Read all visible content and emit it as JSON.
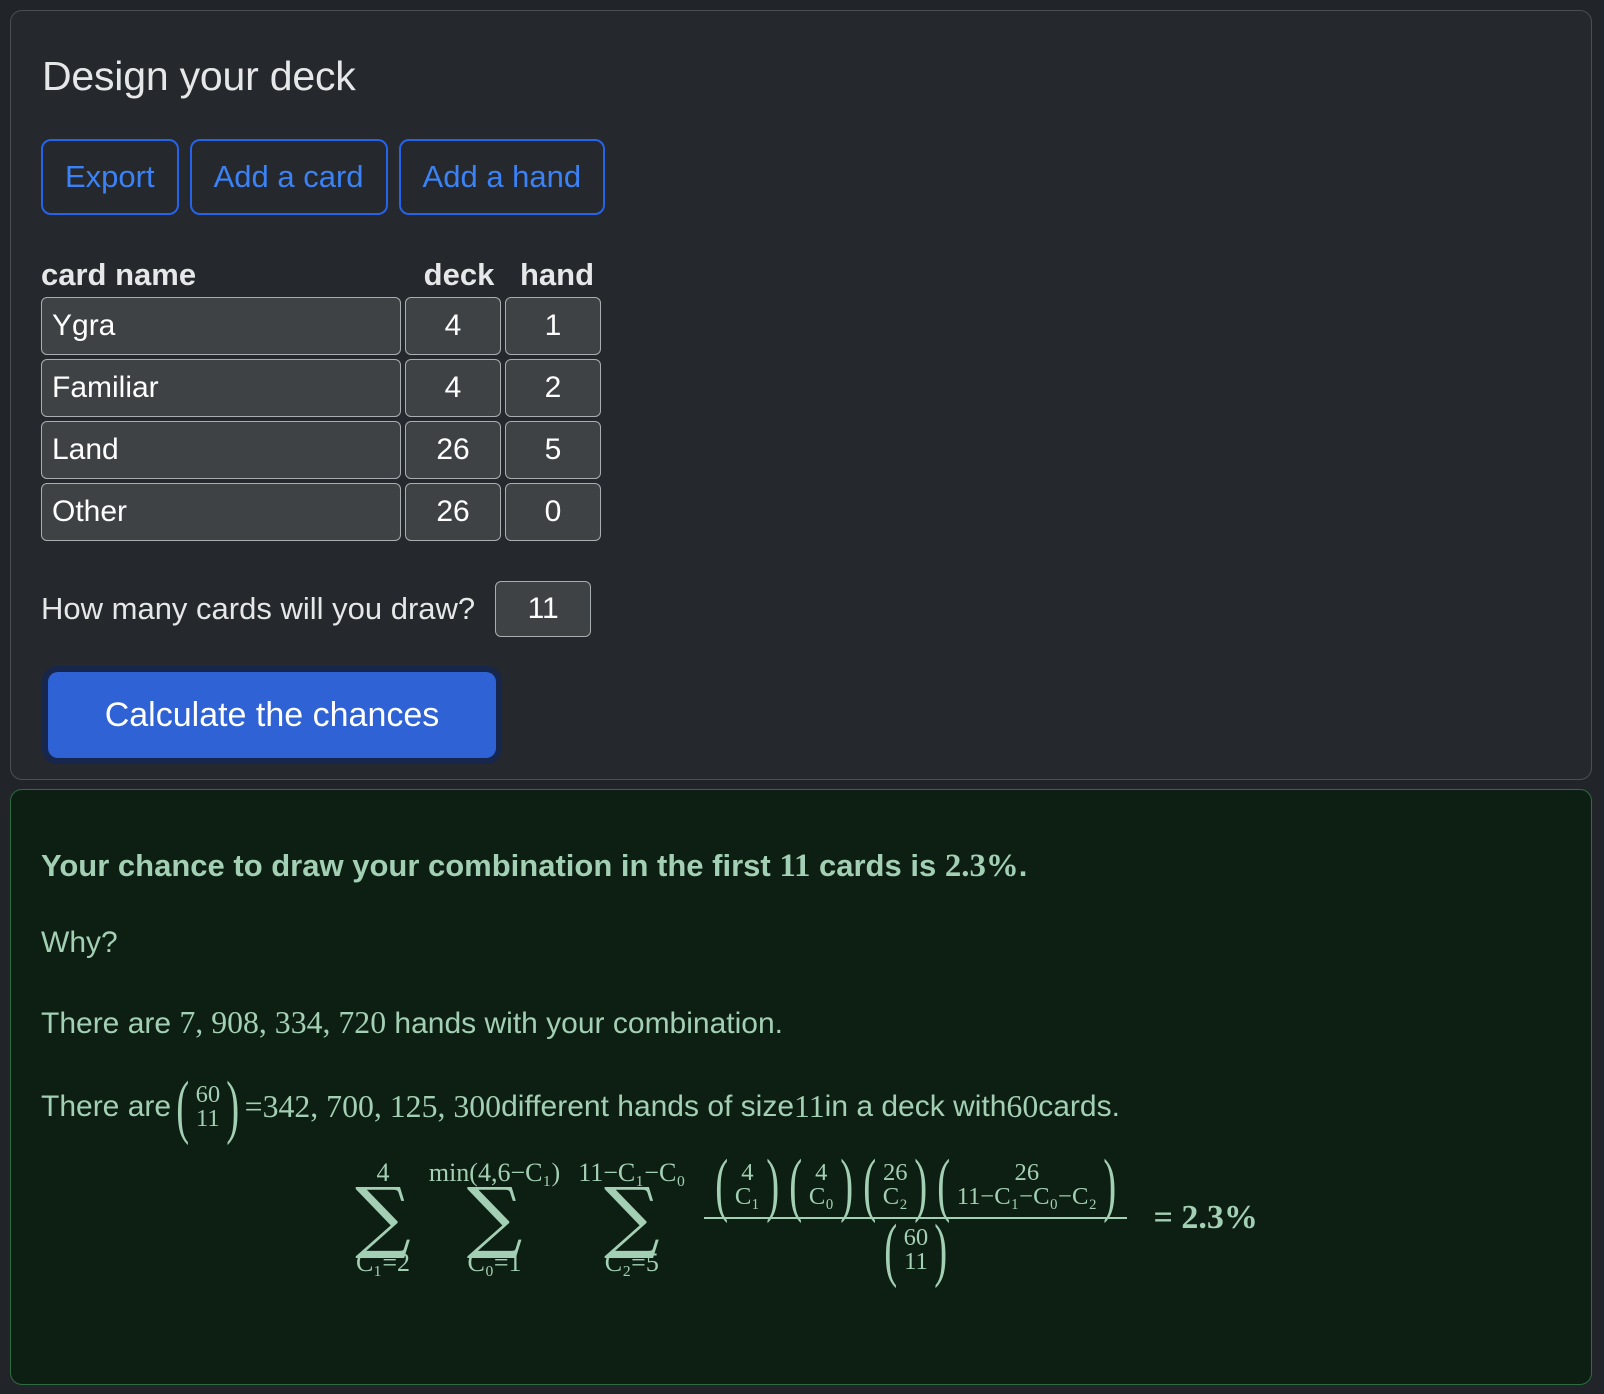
{
  "deck_panel": {
    "title": "Design your deck",
    "buttons": [
      {
        "label": "Export",
        "name": "export-button"
      },
      {
        "label": "Add a card",
        "name": "add-a-card-button"
      },
      {
        "label": "Add a hand",
        "name": "add-a-hand-button"
      }
    ],
    "table": {
      "headers": {
        "name": "card name",
        "deck": "deck",
        "hand": "hand"
      },
      "rows": [
        {
          "name": "Ygra",
          "deck": "4",
          "hand": "1"
        },
        {
          "name": "Familiar",
          "deck": "4",
          "hand": "2"
        },
        {
          "name": "Land",
          "deck": "26",
          "hand": "5"
        },
        {
          "name": "Other",
          "deck": "26",
          "hand": "0"
        }
      ]
    },
    "draw": {
      "label": "How many cards will you draw?",
      "value": "11"
    },
    "calculate_label": "Calculate the chances"
  },
  "result_panel": {
    "headline": {
      "prefix": "Your chance to draw your combination in the first ",
      "draw_count": "11",
      "middle": " cards is ",
      "probability": "2.3%",
      "suffix": "."
    },
    "why_label": "Why?",
    "hands_line": {
      "prefix": "There are ",
      "count": "7, 908, 334, 720",
      "suffix": " hands with your combination."
    },
    "total_line": {
      "prefix": "There are ",
      "binom_top": "60",
      "binom_bottom": "11",
      "equals": " = ",
      "count": "342, 700, 125, 300",
      "middle": " different hands of size ",
      "size": "11",
      "middle2": " in a deck with ",
      "deck_size": "60",
      "suffix": " cards."
    },
    "formula": {
      "sums": [
        {
          "upper": "4",
          "lower": "C₁=2"
        },
        {
          "upper": "min(4,6−C₁)",
          "lower": "C₀=1"
        },
        {
          "upper": "11−C₁−C₀",
          "lower": "C₂=5"
        }
      ],
      "numerator_binoms": [
        {
          "top": "4",
          "bottom": "C₁"
        },
        {
          "top": "4",
          "bottom": "C₀"
        },
        {
          "top": "26",
          "bottom": "C₂"
        },
        {
          "top": "26",
          "bottom": "11−C₁−C₀−C₂"
        }
      ],
      "denominator_binom": {
        "top": "60",
        "bottom": "11"
      },
      "result": "= 2.3%"
    }
  },
  "colors": {
    "page_bg": "#212529",
    "card_bg": "#25282c",
    "card_border": "#4a4f55",
    "accent_blue": "#3b82f6",
    "button_blue": "#2f62d4",
    "alert_bg": "#0d1f12",
    "alert_border": "#2e6b40",
    "alert_text": "#a3cfb4",
    "input_bg": "#3f4245",
    "input_border": "#a9aeb3"
  }
}
